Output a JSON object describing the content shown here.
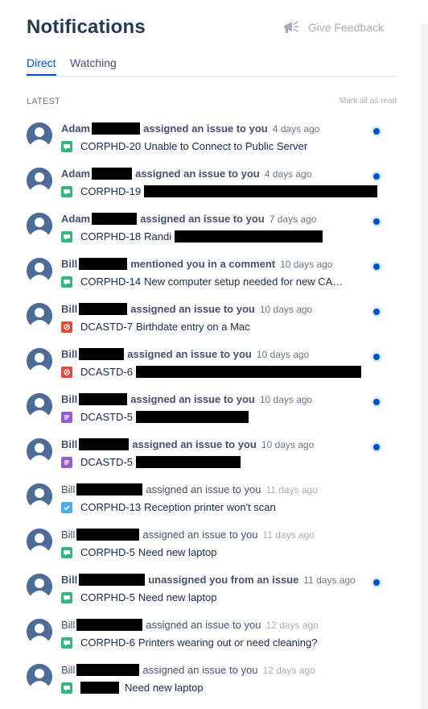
{
  "header": {
    "title": "Notifications",
    "feedback_label": "Give Feedback"
  },
  "tabs": [
    {
      "label": "Direct"
    },
    {
      "label": "Watching"
    }
  ],
  "section": {
    "label": "LATEST",
    "mark_all": "Mark all as read"
  },
  "notifications": [
    {
      "actor": "Adam",
      "action": "assigned an issue to you",
      "time": "4 days ago",
      "issue_key": "CORPHD-20",
      "summary": "Unable to Connect to Public Server",
      "type": "story",
      "unread": true
    },
    {
      "actor": "Adam",
      "action": "assigned an issue to you",
      "time": "4 days ago",
      "issue_key": "CORPHD-19",
      "summary": "",
      "type": "story",
      "unread": true
    },
    {
      "actor": "Adam",
      "action": "assigned an issue to you",
      "time": "7 days ago",
      "issue_key": "CORPHD-18",
      "summary": "Randi",
      "type": "story",
      "unread": true
    },
    {
      "actor": "Bill",
      "action": "mentioned you in a comment",
      "time": "10 days ago",
      "issue_key": "CORPHD-14",
      "summary": "New computer setup needed for new CA…",
      "type": "story",
      "unread": true
    },
    {
      "actor": "Bill",
      "action": "assigned an issue to you",
      "time": "10 days ago",
      "issue_key": "DCASTD-7",
      "summary": "Birthdate entry on a Mac",
      "type": "bug",
      "unread": true
    },
    {
      "actor": "Bill",
      "action": "assigned an issue to you",
      "time": "10 days ago",
      "issue_key": "DCASTD-6",
      "summary": "",
      "type": "bug",
      "unread": true
    },
    {
      "actor": "Bill",
      "action": "assigned an issue to you",
      "time": "10 days ago",
      "issue_key": "DCASTD-5",
      "summary": "",
      "type": "doc",
      "unread": true
    },
    {
      "actor": "Bill",
      "action": "assigned an issue to you",
      "time": "10 days ago",
      "issue_key": "DCASTD-5",
      "summary": "",
      "type": "doc",
      "unread": true
    },
    {
      "actor": "Bill",
      "action": "assigned an issue to you",
      "time": "11 days ago",
      "issue_key": "CORPHD-13",
      "summary": "Reception printer won't scan",
      "type": "task",
      "unread": false
    },
    {
      "actor": "Bill",
      "action": "assigned an issue to you",
      "time": "11 days ago",
      "issue_key": "CORPHD-5",
      "summary": "Need new laptop",
      "type": "story",
      "unread": false
    },
    {
      "actor": "Bill",
      "action": "unassigned you from an issue",
      "time": "11 days ago",
      "issue_key": "CORPHD-5",
      "summary": "Need new laptop",
      "type": "story",
      "unread": true
    },
    {
      "actor": "Bill",
      "action": "assigned an issue to you",
      "time": "12 days ago",
      "issue_key": "CORPHD-6",
      "summary": "Printers wearing out or need cleaning?",
      "type": "story",
      "unread": false
    },
    {
      "actor": "Bill",
      "action": "assigned an issue to you",
      "time": "12 days ago",
      "issue_key": "",
      "summary": "Need new laptop",
      "type": "story",
      "unread": false
    }
  ],
  "icons": {
    "feedback": "megaphone-icon",
    "avatar": "default-user-avatar",
    "unread": "unread-dot-icon"
  },
  "colors": {
    "accent": "#0052CC",
    "story": "#36B37E",
    "bug": "#E5493A",
    "task": "#4BADE8",
    "doc": "#8F60C8"
  }
}
